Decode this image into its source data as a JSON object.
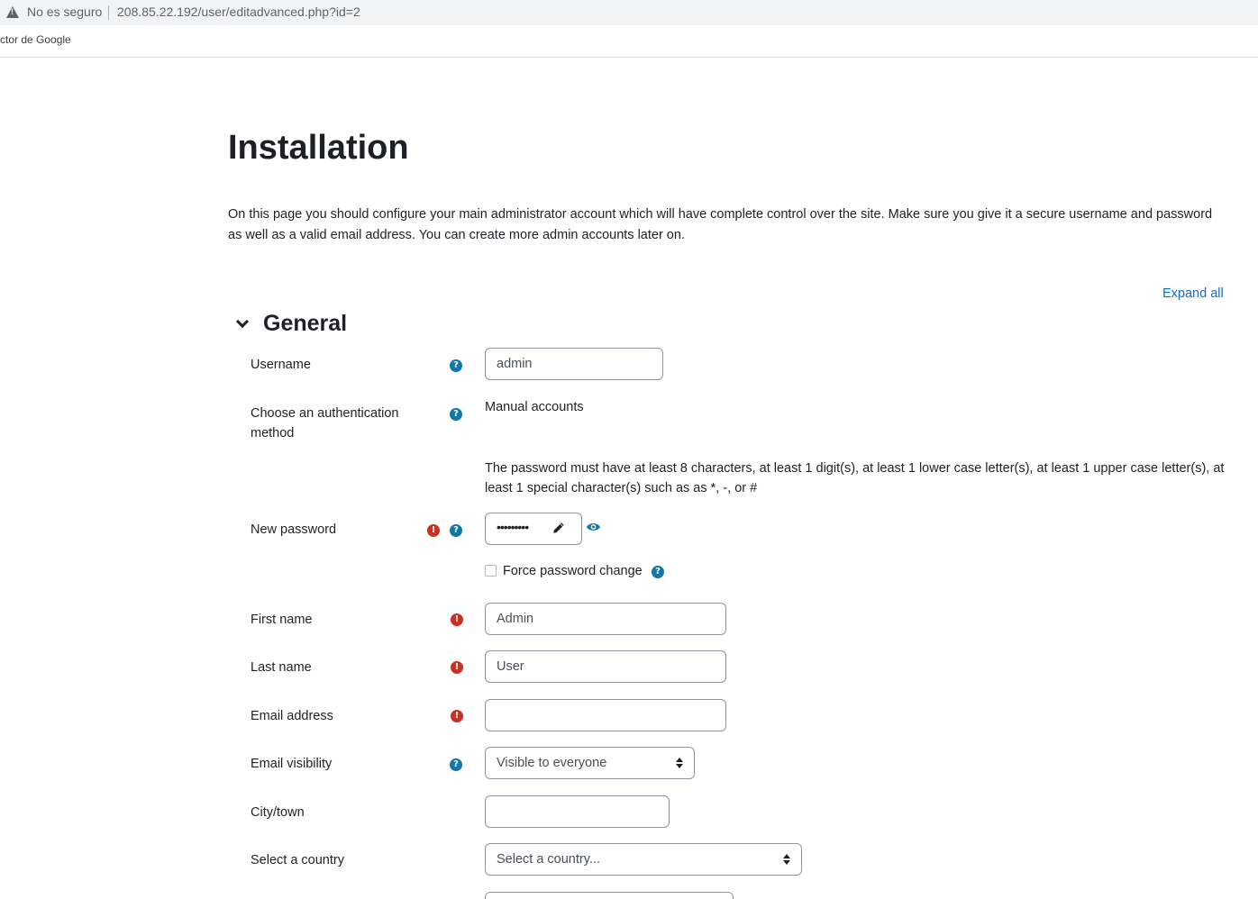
{
  "browser": {
    "security_text": "No es seguro",
    "url": "208.85.22.192/user/editadvanced.php?id=2",
    "bookmark": "ctor de Google"
  },
  "page": {
    "title": "Installation",
    "intro": "On this page you should configure your main administrator account which will have complete control over the site. Make sure you give it a secure username and password as well as a valid email address. You can create more admin accounts later on.",
    "expand_all": "Expand all",
    "section_title": "General"
  },
  "form": {
    "username": {
      "label": "Username",
      "value": "admin"
    },
    "auth": {
      "label": "Choose an authentication method",
      "value": "Manual accounts"
    },
    "password_policy": "The password must have at least 8 characters, at least 1 digit(s), at least 1 lower case letter(s), at least 1 upper case letter(s), at least 1 special character(s) such as as *, -, or #",
    "new_password": {
      "label": "New password",
      "masked_value": "•••••••••"
    },
    "force_change": {
      "label": "Force password change",
      "checked": false
    },
    "first_name": {
      "label": "First name",
      "value": "Admin"
    },
    "last_name": {
      "label": "Last name",
      "value": "User"
    },
    "email": {
      "label": "Email address",
      "value": ""
    },
    "email_visibility": {
      "label": "Email visibility",
      "value": "Visible to everyone"
    },
    "city": {
      "label": "City/town",
      "value": ""
    },
    "country": {
      "label": "Select a country",
      "value": "Select a country..."
    }
  },
  "icons": {
    "help": "question-circle-icon",
    "required": "exclamation-circle-icon",
    "help_glyph": "?",
    "required_glyph": "!"
  },
  "colors": {
    "link": "#0f6cbf",
    "help_icon": "#1178a5",
    "required_icon": "#ca3120",
    "text": "#1d2125"
  }
}
